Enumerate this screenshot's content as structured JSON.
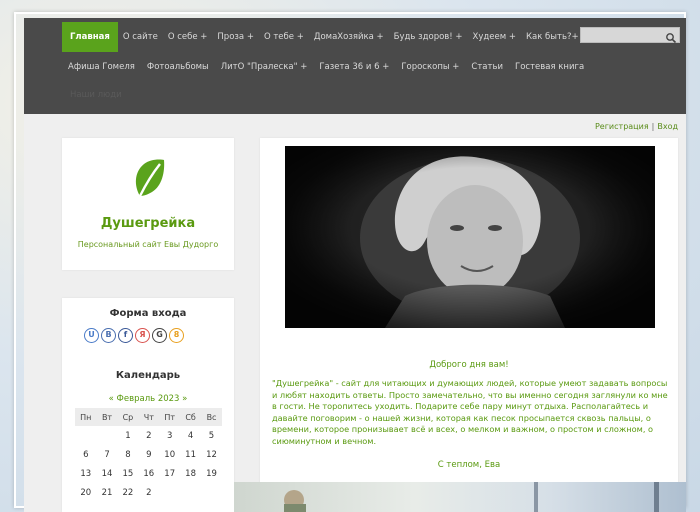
{
  "nav": {
    "row1": [
      {
        "label": "Главная",
        "active": true
      },
      {
        "label": "О сайте"
      },
      {
        "label": "О себе +"
      },
      {
        "label": "Проза +"
      },
      {
        "label": "О тебе +"
      },
      {
        "label": "ДомаХозяйка +"
      },
      {
        "label": "Будь здоров! +"
      },
      {
        "label": "Худеем +"
      },
      {
        "label": "Как быть?+"
      }
    ],
    "row2": [
      {
        "label": "Афиша Гомеля"
      },
      {
        "label": "Фотоальбомы"
      },
      {
        "label": "ЛитО \"Пралеска\" +"
      },
      {
        "label": "Газета 36 и 6 +"
      },
      {
        "label": "Гороскопы +"
      },
      {
        "label": "Статьи"
      },
      {
        "label": "Гостевая книга"
      }
    ],
    "row3_label": "Наши люди"
  },
  "search": {
    "placeholder": "",
    "icon": "search-icon"
  },
  "auth": {
    "register": "Регистрация",
    "login": "Вход"
  },
  "logo": {
    "icon": "leaf-icon",
    "name": "Душегрейка",
    "subtitle": "Персональный сайт Евы Дудорго"
  },
  "login_form": {
    "title": "Форма входа",
    "socials": [
      {
        "letter": "U",
        "color": "#4a7bc8"
      },
      {
        "letter": "B",
        "color": "#4a6fb0"
      },
      {
        "letter": "f",
        "color": "#3b5998"
      },
      {
        "letter": "Я",
        "color": "#d9534f"
      },
      {
        "letter": "G",
        "color": "#444444"
      },
      {
        "letter": "8",
        "color": "#e8a020"
      }
    ]
  },
  "calendar": {
    "title": "Календарь",
    "month": "« Февраль 2023 »",
    "weekdays": [
      "Пн",
      "Вт",
      "Ср",
      "Чт",
      "Пт",
      "Сб",
      "Вс"
    ],
    "weeks": [
      [
        "",
        "",
        "1",
        "2",
        "3",
        "4",
        "5"
      ],
      [
        "6",
        "7",
        "8",
        "9",
        "10",
        "11",
        "12"
      ],
      [
        "13",
        "14",
        "15",
        "16",
        "17",
        "18",
        "19"
      ],
      [
        "20",
        "21",
        "22",
        "2",
        "",
        "",
        ""
      ]
    ]
  },
  "main": {
    "welcome": "Доброго дня вам!",
    "intro": "\"Душегрейка\" - сайт для читающих и думающих людей, которые умеют задавать вопросы и любят находить ответы. Просто замечательно, что вы именно сегодня заглянули ко мне в гости. Не торопитесь уходить. Подарите себе пару минут отдыха. Располагайтесь и давайте поговорим - о нашей жизни, которая как песок просыпается сквозь пальцы, о времени, которое пронизывает всё и всех, о мелком и важном, о простом и сложном, о сиюминутном и вечном.",
    "signoff": "С теплом, Ева"
  },
  "colors": {
    "accent": "#5aa31c",
    "nav_bg": "#4a4a4a",
    "link": "#5a9a10"
  }
}
